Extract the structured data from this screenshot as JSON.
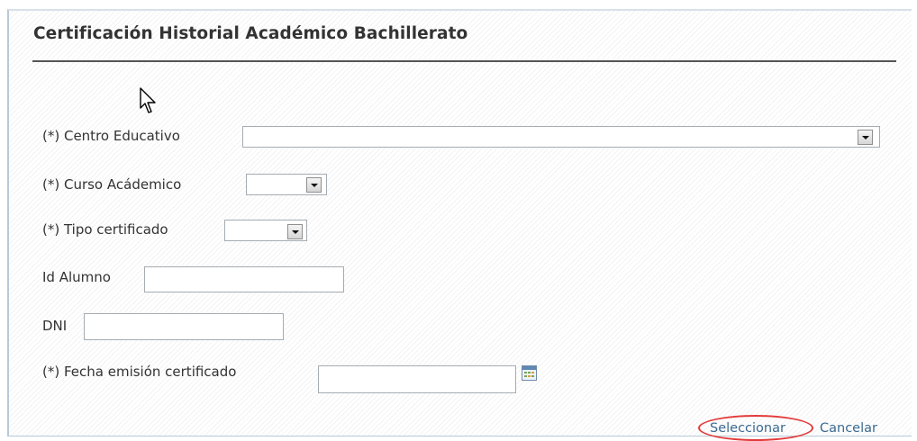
{
  "form": {
    "title": "Certificación Historial Académico Bachillerato",
    "fields": {
      "centro_label": "(*) Centro Educativo",
      "curso_label": "(*) Curso Acádemico",
      "tipo_label": "(*) Tipo certificado",
      "idalumno_label": "Id Alumno",
      "dni_label": "DNI",
      "fecha_label": "(*) Fecha emisión certificado"
    },
    "values": {
      "centro": "",
      "curso": "",
      "tipo": "",
      "idalumno": "",
      "dni": "",
      "fecha": ""
    }
  },
  "actions": {
    "select_label": "Seleccionar",
    "cancel_label": "Cancelar"
  },
  "icons": {
    "cursor": "mouse-pointer-icon",
    "dropdown": "chevron-down-icon",
    "calendar": "calendar-icon"
  },
  "colors": {
    "link": "#3c6a90",
    "annotation": "#e33b3b",
    "rule": "#555555"
  }
}
